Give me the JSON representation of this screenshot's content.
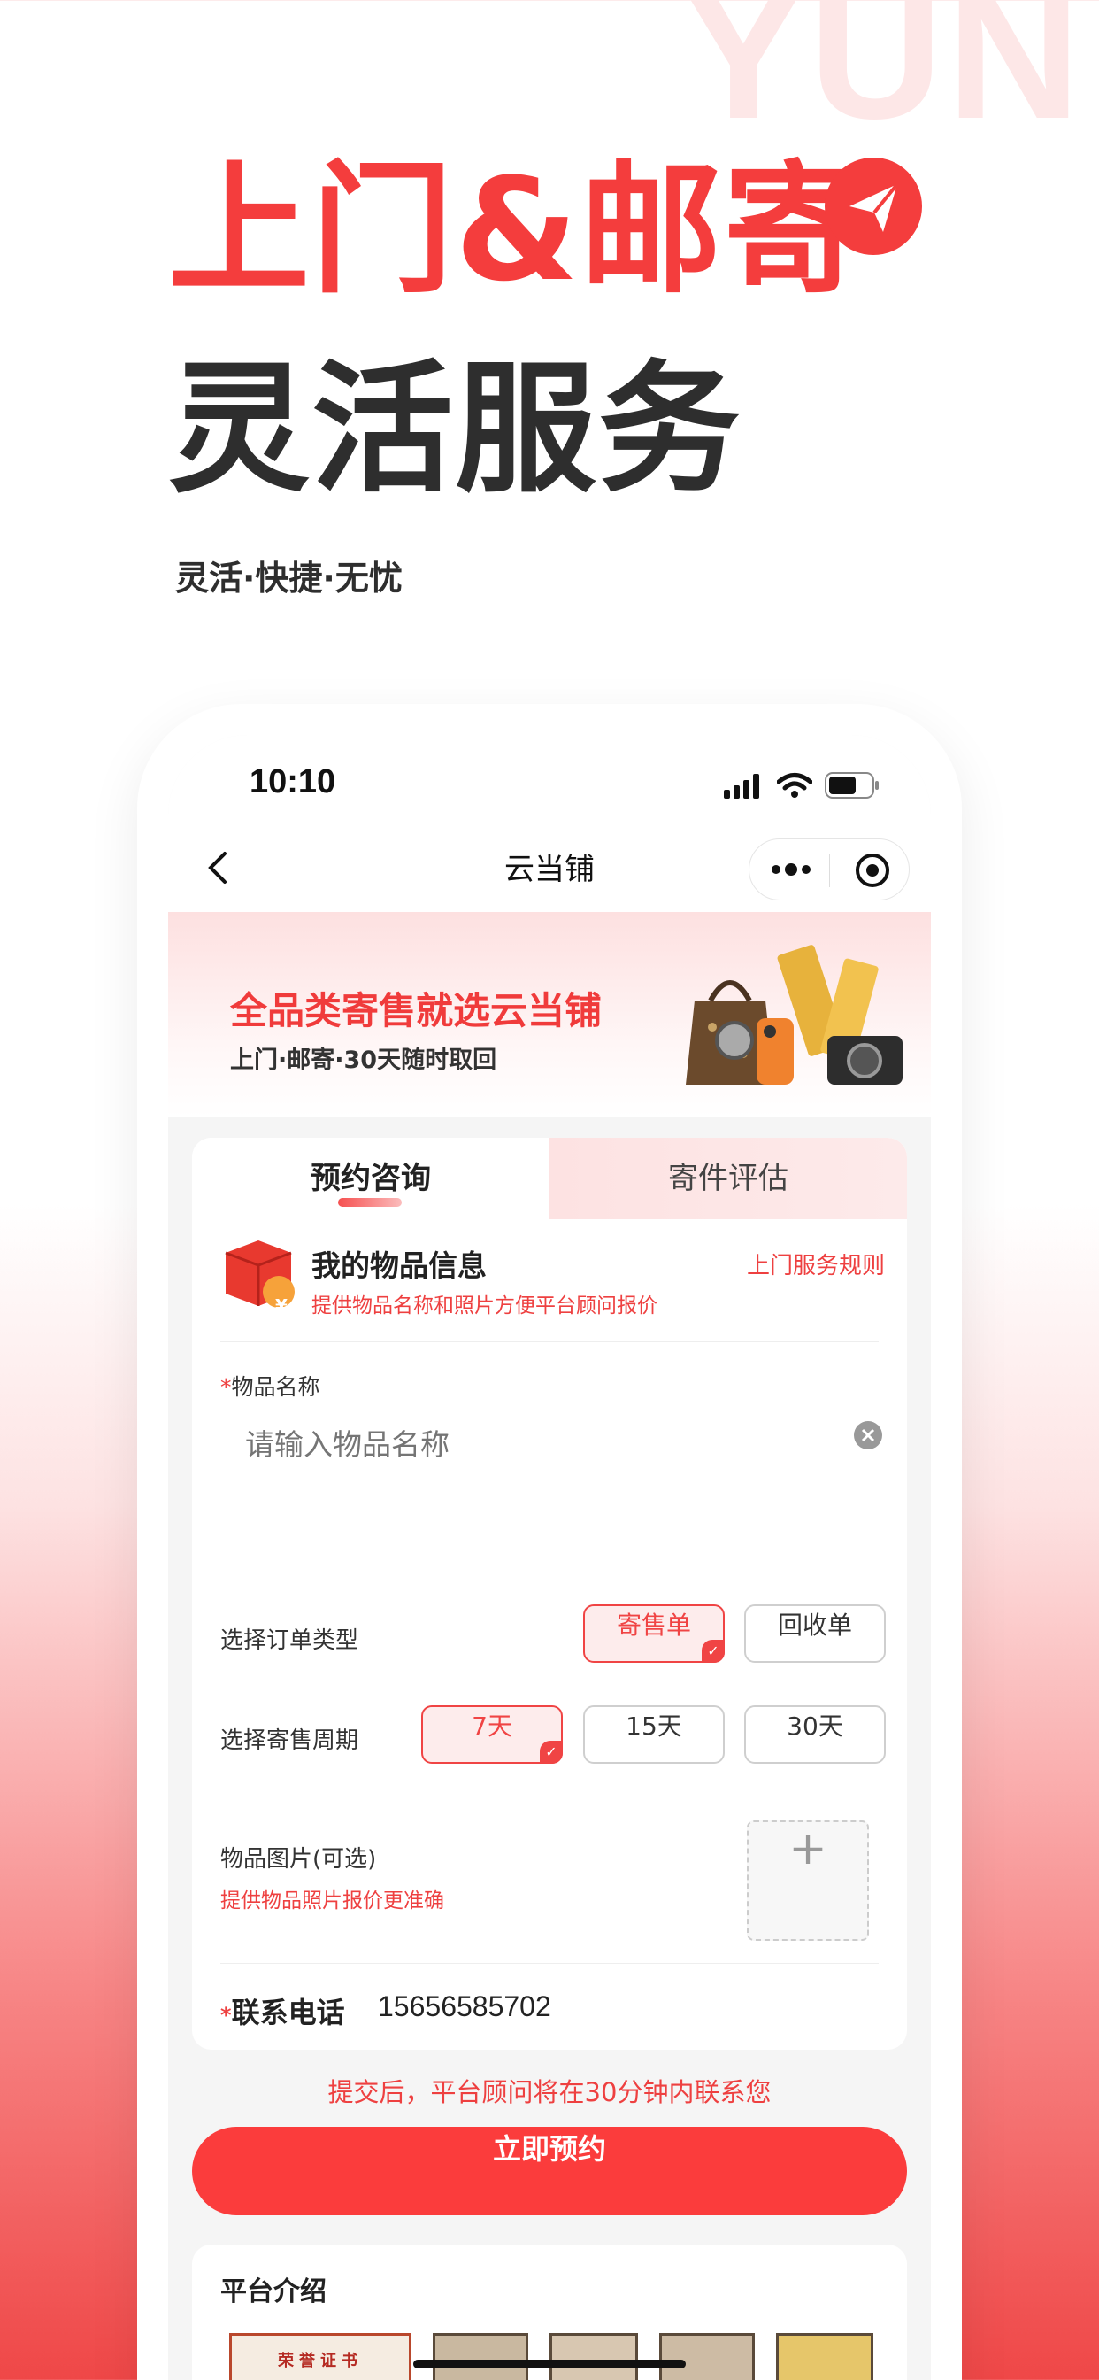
{
  "watermark": "YUN",
  "hero": {
    "line1": "上门&邮寄",
    "line2": "灵活服务",
    "subtitle": "灵活·快捷·无忧",
    "plane_icon": "paper-plane-icon"
  },
  "status_bar": {
    "time": "10:10",
    "icons": [
      "signal-icon",
      "wifi-icon",
      "battery-icon"
    ]
  },
  "nav": {
    "back_icon": "chevron-left-icon",
    "title": "云当铺",
    "menu_icon": "more-dots-icon",
    "close_icon": "target-circle-icon"
  },
  "banner": {
    "title": "全品类寄售就选云当铺",
    "subtitle": "上门·邮寄·30天随时取回"
  },
  "tabs": [
    {
      "label": "预约咨询",
      "active": true
    },
    {
      "label": "寄件评估",
      "active": false
    }
  ],
  "form": {
    "header_title": "我的物品信息",
    "header_desc": "提供物品名称和照片方便平台顾问报价",
    "rules_link": "上门服务规则",
    "item_name_required": "*",
    "item_name_label": "物品名称",
    "item_name_placeholder": "请输入物品名称",
    "order_type_label": "选择订单类型",
    "order_types": [
      {
        "label": "寄售单",
        "selected": true
      },
      {
        "label": "回收单",
        "selected": false
      }
    ],
    "period_label": "选择寄售周期",
    "periods": [
      {
        "label": "7天",
        "selected": true
      },
      {
        "label": "15天",
        "selected": false
      },
      {
        "label": "30天",
        "selected": false
      }
    ],
    "photo_label": "物品图片(可选)",
    "photo_hint": "提供物品照片报价更准确",
    "upload_symbol": "+",
    "phone_required": "*",
    "phone_label": "联系电话",
    "phone_value": "15656585702"
  },
  "submit": {
    "note": "提交后，平台顾问将在30分钟内联系您",
    "button": "立即预约"
  },
  "platform": {
    "title": "平台介绍",
    "certificate_text": "荣誉证书"
  },
  "colors": {
    "accent": "#f43d3d",
    "text_dark": "#2e2e2e",
    "hint_red": "#ee4040"
  }
}
